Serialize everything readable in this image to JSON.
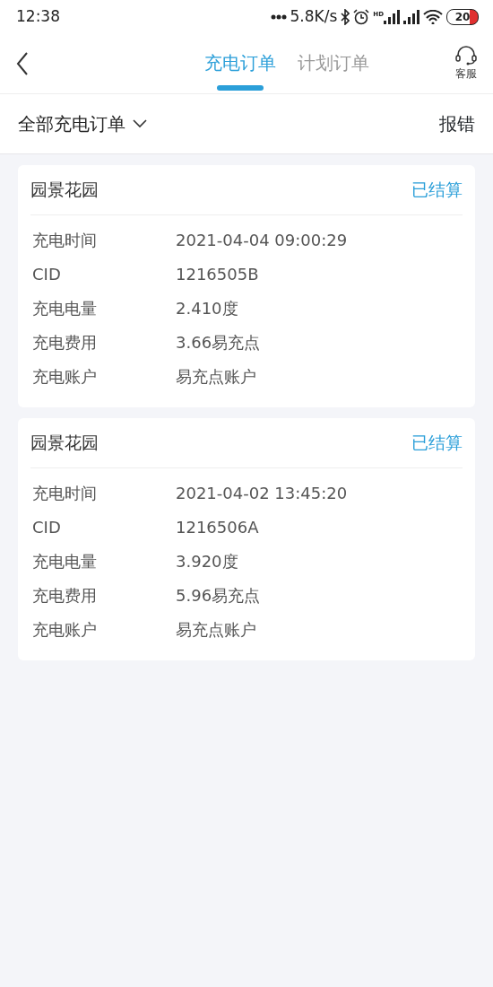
{
  "status_bar": {
    "time": "12:38",
    "network_speed": "5.8K/s",
    "hd": "HD",
    "battery": "20"
  },
  "header": {
    "tabs": [
      {
        "label": "充电订单",
        "selected": true
      },
      {
        "label": "计划订单",
        "selected": false
      }
    ],
    "service_label": "客服"
  },
  "filter": {
    "label": "全部充电订单",
    "report": "报错"
  },
  "orders": [
    {
      "station": "园景花园",
      "status": "已结算",
      "fields": [
        {
          "label": "充电时间",
          "value": "2021-04-04 09:00:29"
        },
        {
          "label": "CID",
          "value": "1216505B"
        },
        {
          "label": "充电电量",
          "value": "2.410度"
        },
        {
          "label": "充电费用",
          "value": "3.66易充点"
        },
        {
          "label": "充电账户",
          "value": "易充点账户"
        }
      ]
    },
    {
      "station": "园景花园",
      "status": "已结算",
      "fields": [
        {
          "label": "充电时间",
          "value": "2021-04-02 13:45:20"
        },
        {
          "label": "CID",
          "value": "1216506A"
        },
        {
          "label": "充电电量",
          "value": "3.920度"
        },
        {
          "label": "充电费用",
          "value": "5.96易充点"
        },
        {
          "label": "充电账户",
          "value": "易充点账户"
        }
      ]
    }
  ]
}
